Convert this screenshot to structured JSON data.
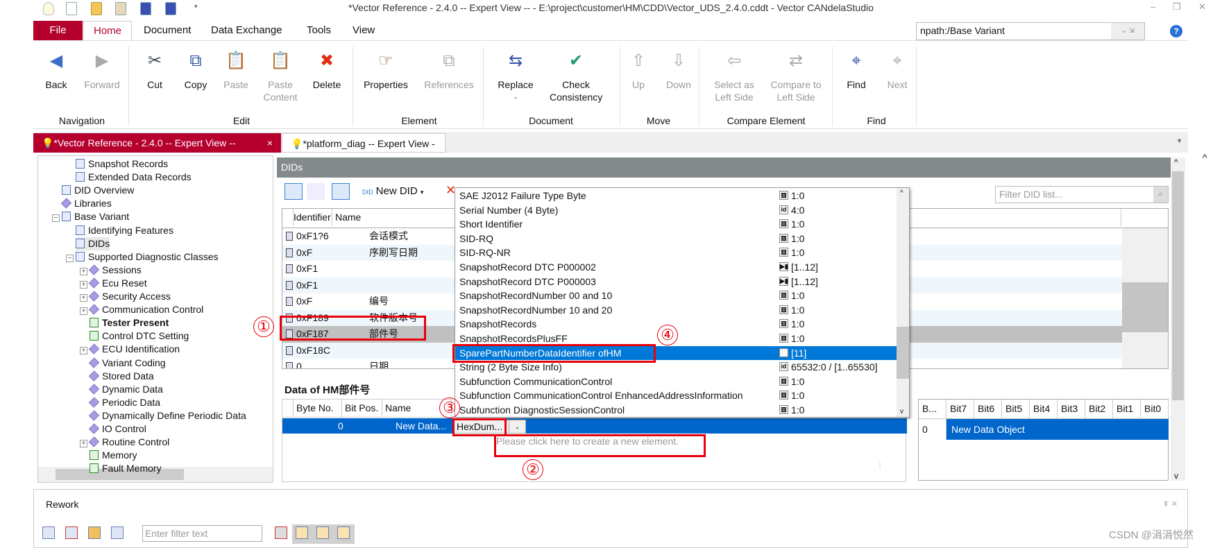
{
  "window": {
    "title": "*Vector Reference - 2.4.0 -- Expert View -- - E:\\project\\customer\\HM\\CDD\\Vector_UDS_2.4.0.cddt - Vector CANdelaStudio",
    "minimize": "–",
    "restore": "❐",
    "close": "✕"
  },
  "ribbon_tabs": [
    "File",
    "Home",
    "Document",
    "Data Exchange",
    "Tools",
    "View"
  ],
  "npath": {
    "value": "npath:/Base Variant",
    "arrows": "⌄ ⇲",
    "help": "?"
  },
  "ribbon": {
    "buttons": [
      {
        "label": "Back",
        "icon": "back-arrow-icon",
        "glyph": "◀",
        "enabled": true,
        "color": "#3b6fc7"
      },
      {
        "label": "Forward",
        "icon": "forward-arrow-icon",
        "glyph": "▶",
        "enabled": false,
        "color": "#aaaaaa"
      },
      {
        "label": "Cut",
        "icon": "scissors-icon",
        "glyph": "✂",
        "enabled": true,
        "color": "#345"
      },
      {
        "label": "Copy",
        "icon": "copy-icon",
        "glyph": "⧉",
        "enabled": true,
        "color": "#2f4fa8"
      },
      {
        "label": "Paste",
        "icon": "paste-icon",
        "glyph": "📋",
        "enabled": false,
        "color": "#aaaaaa"
      },
      {
        "label": "Paste\nContent",
        "icon": "paste-content-icon",
        "glyph": "📋",
        "enabled": false,
        "color": "#aaaaaa"
      },
      {
        "label": "Delete",
        "icon": "delete-x-icon",
        "glyph": "✖",
        "enabled": true,
        "color": "#e03010"
      },
      {
        "label": "Properties",
        "icon": "pointing-hand-icon",
        "glyph": "☞",
        "enabled": true,
        "color": "#8a6a3a"
      },
      {
        "label": "References",
        "icon": "references-icon",
        "glyph": "⧉",
        "enabled": false,
        "color": "#aaaaaa"
      },
      {
        "label": "Replace\n·",
        "icon": "replace-icon",
        "glyph": "⇆",
        "enabled": true,
        "color": "#2f4fa8"
      },
      {
        "label": "Check\nConsistency",
        "icon": "lightbulb-check-icon",
        "glyph": "✔",
        "enabled": true,
        "color": "#1a9a7a"
      },
      {
        "label": "Up",
        "icon": "up-arrow-icon",
        "glyph": "⇧",
        "enabled": false,
        "color": "#aaaaaa"
      },
      {
        "label": "Down",
        "icon": "down-arrow-icon",
        "glyph": "⇩",
        "enabled": false,
        "color": "#aaaaaa"
      },
      {
        "label": "Select as\nLeft Side",
        "icon": "select-left-icon",
        "glyph": "⇦",
        "enabled": false,
        "color": "#aaaaaa"
      },
      {
        "label": "Compare to\nLeft Side",
        "icon": "compare-icon",
        "glyph": "⇄",
        "enabled": false,
        "color": "#aaaaaa"
      },
      {
        "label": "Find",
        "icon": "binoculars-icon",
        "glyph": "⌖",
        "enabled": true,
        "color": "#2f4fa8"
      },
      {
        "label": "Next",
        "icon": "find-next-icon",
        "glyph": "⌖",
        "enabled": false,
        "color": "#aaaaaa"
      }
    ],
    "groups": [
      "Navigation",
      "Edit",
      "Element",
      "Document",
      "Move",
      "Compare Element",
      "Find"
    ],
    "collapse": "^"
  },
  "doc_tabs": [
    {
      "label": "*Vector Reference - 2.4.0 -- Expert View --",
      "close": "×",
      "active": true
    },
    {
      "label": "*platform_diag -- Expert View --",
      "active": false
    }
  ],
  "tree": [
    {
      "label": "Snapshot Records",
      "level": 2,
      "icon": "doc"
    },
    {
      "label": "Extended Data Records",
      "level": 2,
      "icon": "doc"
    },
    {
      "label": "DID Overview",
      "level": 1,
      "icon": "doc"
    },
    {
      "label": "Libraries",
      "level": 1,
      "icon": "book"
    },
    {
      "label": "Base Variant",
      "level": 1,
      "icon": "doc",
      "exp": "−"
    },
    {
      "label": "Identifying Features",
      "level": 2,
      "icon": "doc"
    },
    {
      "label": "DIDs",
      "level": 2,
      "icon": "doc",
      "selected": true
    },
    {
      "label": "Supported Diagnostic Classes",
      "level": 2,
      "icon": "doc",
      "exp": "−"
    },
    {
      "label": "Sessions",
      "level": 3,
      "icon": "book",
      "exp": "+"
    },
    {
      "label": "Ecu Reset",
      "level": 3,
      "icon": "book",
      "exp": "+"
    },
    {
      "label": "Security Access",
      "level": 3,
      "icon": "book",
      "exp": "+"
    },
    {
      "label": "Communication Control",
      "level": 3,
      "icon": "book",
      "exp": "+"
    },
    {
      "label": "Tester Present",
      "level": 3,
      "icon": "grn",
      "bold": true
    },
    {
      "label": "Control DTC Setting",
      "level": 3,
      "icon": "grn"
    },
    {
      "label": "ECU Identification",
      "level": 3,
      "icon": "book",
      "exp": "+"
    },
    {
      "label": "Variant Coding",
      "level": 3,
      "icon": "book"
    },
    {
      "label": "Stored Data",
      "level": 3,
      "icon": "book"
    },
    {
      "label": "Dynamic Data",
      "level": 3,
      "icon": "book"
    },
    {
      "label": "Periodic Data",
      "level": 3,
      "icon": "book"
    },
    {
      "label": "Dynamically Define Periodic Data",
      "level": 3,
      "icon": "book"
    },
    {
      "label": "IO Control",
      "level": 3,
      "icon": "book"
    },
    {
      "label": "Routine Control",
      "level": 3,
      "icon": "book",
      "exp": "+"
    },
    {
      "label": "Memory",
      "level": 3,
      "icon": "grn"
    },
    {
      "label": "Fault Memory",
      "level": 3,
      "icon": "grn"
    }
  ],
  "dids": {
    "header": "DIDs",
    "new_did": "New DID",
    "filter_placeholder": "Filter DID list...",
    "columns": [
      "Identifier",
      "Name"
    ],
    "rows": [
      {
        "id": "0xF1?6",
        "name": "会话模式"
      },
      {
        "id": "0xF",
        "name": "序刷写日期"
      },
      {
        "id": "0xF1",
        "name": ""
      },
      {
        "id": "0xF1",
        "name": ""
      },
      {
        "id": "0xF",
        "name": "编号"
      },
      {
        "id": "0xF189",
        "name": "软件版本号"
      },
      {
        "id": "0xF187",
        "name": "部件号",
        "selected": true
      },
      {
        "id": "0xF18C",
        "name": ""
      },
      {
        "id": "0",
        "name": "日期"
      }
    ]
  },
  "data_of": {
    "title": "Data of HM部件号",
    "columns": [
      "Byte No.",
      "Bit Pos.",
      "Name"
    ],
    "row": {
      "byte": "0",
      "name": "New Data...",
      "type": "HexDum..."
    },
    "placeholder": "Please click here to create a new element."
  },
  "bit_table": {
    "columns": [
      "B...",
      "Bit7",
      "Bit6",
      "Bit5",
      "Bit4",
      "Bit3",
      "Bit2",
      "Bit1",
      "Bit0"
    ],
    "row": {
      "byte": "0",
      "label": "New Data Object"
    }
  },
  "popup_items": [
    {
      "name": "SAE J2012 Failure Type Byte",
      "type": "table",
      "value": "1:0"
    },
    {
      "name": "Serial Number (4 Byte)",
      "type": "id",
      "value": "4:0"
    },
    {
      "name": "Short Identifier",
      "type": "table",
      "value": "1:0"
    },
    {
      "name": "SID-RQ",
      "type": "table",
      "value": "1:0"
    },
    {
      "name": "SID-RQ-NR",
      "type": "table",
      "value": "1:0"
    },
    {
      "name": "SnapshotRecord DTC P000002",
      "type": "struct",
      "value": "[1..12]"
    },
    {
      "name": "SnapshotRecord DTC P000003",
      "type": "struct",
      "value": "[1..12]"
    },
    {
      "name": "SnapshotRecordNumber 00 and 10",
      "type": "table",
      "value": "1:0"
    },
    {
      "name": "SnapshotRecordNumber 10 and 20",
      "type": "table",
      "value": "1:0"
    },
    {
      "name": "SnapshotRecords",
      "type": "table",
      "value": "1:0"
    },
    {
      "name": "SnapshotRecordsPlusFF",
      "type": "table",
      "value": "1:0"
    },
    {
      "name": "SparePartNumberDataIdentifier ofHM",
      "type": "id",
      "value": "[11]",
      "selected": true
    },
    {
      "name": "String (2 Byte Size Info)",
      "type": "id",
      "value": "65532:0 / [1..65530]"
    },
    {
      "name": "Subfunction CommunicationControl",
      "type": "table",
      "value": "1:0"
    },
    {
      "name": "Subfunction CommunicationControl EnhancedAddressInformation",
      "type": "table",
      "value": "1:0"
    },
    {
      "name": "Subfunction DiagnosticSessionControl",
      "type": "table",
      "value": "1:0"
    }
  ],
  "annotations": [
    "①",
    "②",
    "③",
    "④"
  ],
  "rework": {
    "title": "Rework",
    "filter_placeholder": "Enter filter text",
    "pin": "⇞ ✕"
  },
  "watermark": "CSDN @涓涓悦然",
  "colors": {
    "brand": "#b5002e",
    "selection": "#0078d7",
    "annotation": "#e8000b"
  }
}
